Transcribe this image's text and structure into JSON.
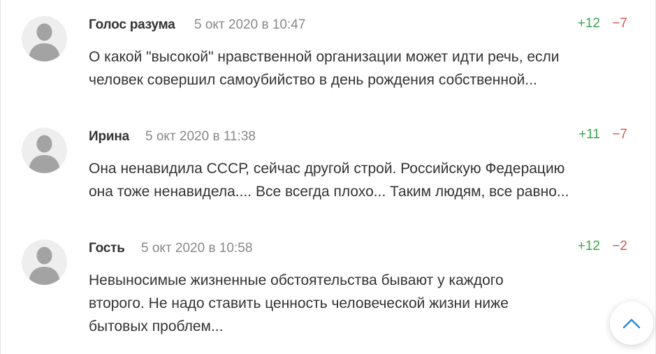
{
  "comments": [
    {
      "author": "Голос разума",
      "date": "5 окт 2020 в 10:47",
      "plus": "+12",
      "minus": "−7",
      "text": "О какой \"высокой\" нравственной организации может идти речь, если\nчеловек совершил самоубийство в день рождения собственной..."
    },
    {
      "author": "Ирина",
      "date": "5 окт 2020 в 11:38",
      "plus": "+11",
      "minus": "−7",
      "text": "Она ненавидила СССР, сейчас другой строй. Российскую Федерацию\nона тоже ненавидела.... Все всегда плохо... Таким людям, все равно..."
    },
    {
      "author": "Гость",
      "date": "5 окт 2020 в 10:58",
      "plus": "+12",
      "minus": "−2",
      "text": "Невыносимые жизненные обстоятельства бывают у каждого\nвторого. Не надо ставить ценность человеческой жизни ниже\nбытовых проблем..."
    }
  ],
  "icons": {
    "avatar": "user-silhouette-icon",
    "scroll_top": "chevron-up-icon"
  },
  "colors": {
    "plus": "#3aa64f",
    "minus": "#d9534f",
    "accent": "#2a8fd6"
  }
}
